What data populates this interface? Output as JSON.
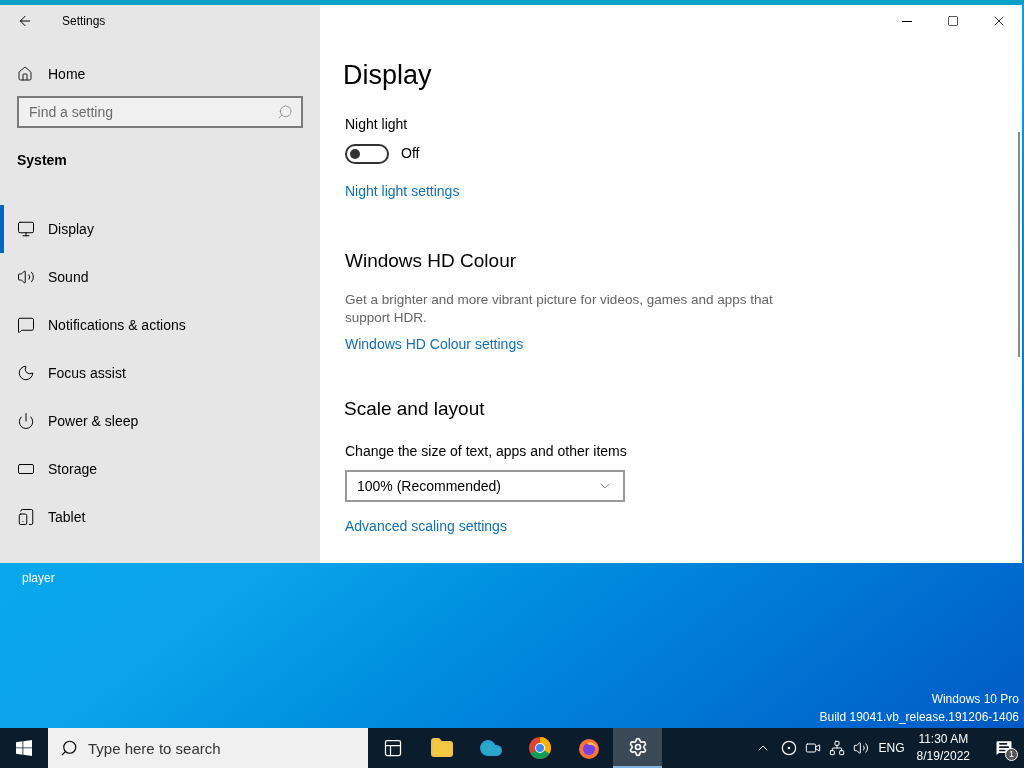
{
  "window": {
    "title": "Settings"
  },
  "sidebar": {
    "home": "Home",
    "search": {
      "placeholder": "Find a setting"
    },
    "section": "System",
    "items": [
      {
        "kind": "display",
        "label": "Display",
        "selected": true
      },
      {
        "kind": "sound",
        "label": "Sound",
        "selected": false
      },
      {
        "kind": "notifications",
        "label": "Notifications & actions",
        "selected": false
      },
      {
        "kind": "focus",
        "label": "Focus assist",
        "selected": false
      },
      {
        "kind": "power",
        "label": "Power & sleep",
        "selected": false
      },
      {
        "kind": "storage",
        "label": "Storage",
        "selected": false
      },
      {
        "kind": "tablet",
        "label": "Tablet",
        "selected": false
      }
    ]
  },
  "content": {
    "title": "Display",
    "night_light": {
      "label": "Night light",
      "on": false,
      "state_text": "Off",
      "link": "Night light settings"
    },
    "hd_colour": {
      "heading": "Windows HD Colour",
      "description": "Get a brighter and more vibrant picture for videos, games and apps that support HDR.",
      "link": "Windows HD Colour settings"
    },
    "scale": {
      "heading": "Scale and layout",
      "label": "Change the size of text, apps and other items",
      "value": "100% (Recommended)",
      "link": "Advanced scaling settings"
    }
  },
  "desktop": {
    "icon_label": "player",
    "watermark_lines": [
      "Windows 10 Pro",
      "Build 19041.vb_release.191206-1406"
    ]
  },
  "taskbar": {
    "search": {
      "placeholder": "Type here to search"
    },
    "apps": [
      {
        "kind": "taskview",
        "selected": false
      },
      {
        "kind": "explorer",
        "selected": false
      },
      {
        "kind": "cloud",
        "selected": false
      },
      {
        "kind": "chrome",
        "selected": false
      },
      {
        "kind": "firefox",
        "selected": false
      },
      {
        "kind": "settings",
        "selected": true
      }
    ],
    "language": "ENG",
    "time": "11:30 AM",
    "date": "8/19/2022",
    "notification_count": "1"
  }
}
